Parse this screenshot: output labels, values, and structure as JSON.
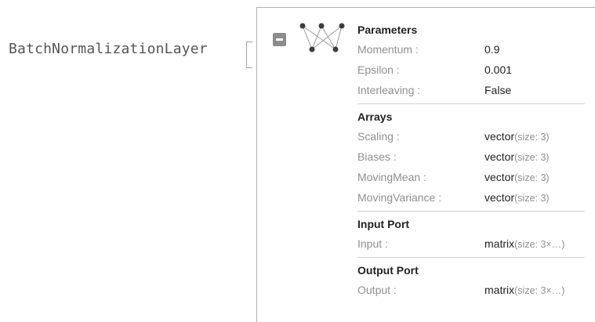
{
  "layer": {
    "name": "BatchNormalizationLayer"
  },
  "icons": {
    "collapse": "collapse-minus-icon",
    "layer": "network-graph-icon"
  },
  "sections": {
    "parameters": {
      "title": "Parameters",
      "rows": [
        {
          "key": "Momentum :",
          "value": "0.9"
        },
        {
          "key": "Epsilon :",
          "value": "0.001"
        },
        {
          "key": "Interleaving :",
          "value": "False"
        }
      ]
    },
    "arrays": {
      "title": "Arrays",
      "rows": [
        {
          "key": "Scaling :",
          "value": "vector",
          "note": "(size: 3)"
        },
        {
          "key": "Biases :",
          "value": "vector",
          "note": "(size: 3)"
        },
        {
          "key": "MovingMean :",
          "value": "vector",
          "note": "(size: 3)"
        },
        {
          "key": "MovingVariance :",
          "value": "vector",
          "note": "(size: 3)"
        }
      ]
    },
    "input_port": {
      "title": "Input Port",
      "rows": [
        {
          "key": "Input :",
          "value": "matrix",
          "note": "(size: 3×…)"
        }
      ]
    },
    "output_port": {
      "title": "Output Port",
      "rows": [
        {
          "key": "Output :",
          "value": "matrix",
          "note": "(size: 3×…)"
        }
      ]
    }
  },
  "colors": {
    "key_text": "#8f8f8f",
    "value_text": "#222222",
    "icon_gray": "#8c8c8c",
    "node_dark": "#3c3c3c"
  }
}
